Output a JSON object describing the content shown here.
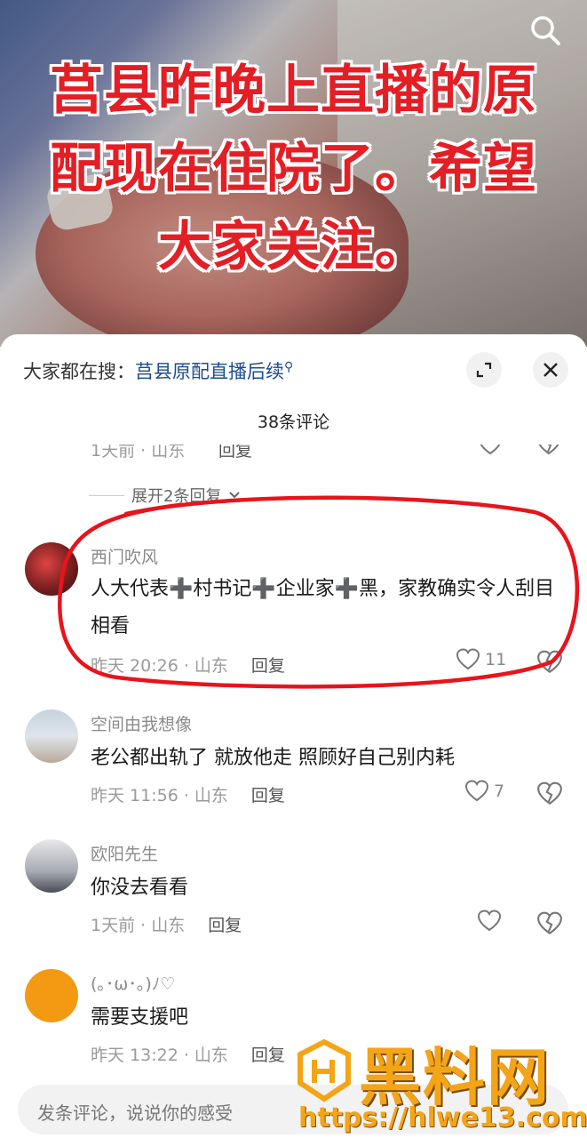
{
  "video": {
    "headline_line1": "莒县昨晚上直播的原",
    "headline_line2": "配现在住院了。希望",
    "headline_line3": "大家关注。"
  },
  "panel": {
    "topic_prefix": "大家都在搜：",
    "topic_link": "莒县原配直播后续",
    "comment_count": "38条评论",
    "partial_meta": "1天前 · 山东",
    "partial_reply": "回复",
    "expand_label": "展开2条回复"
  },
  "comments": [
    {
      "username": "西门吹风",
      "text": "人大代表➕村书记➕企业家➕黑，家教确实令人刮目相看",
      "time_loc": "昨天 20:26 · 山东",
      "reply": "回复",
      "likes": "11",
      "avatar_color": "#8a2a2a"
    },
    {
      "username": "空间由我想像",
      "text": "老公都出轨了 就放他走 照顾好自己别内耗",
      "time_loc": "昨天 11:56 · 山东",
      "reply": "回复",
      "likes": "7",
      "avatar_color": "#c9d3de"
    },
    {
      "username": "欧阳先生",
      "text": "你没去看看",
      "time_loc": "1天前 · 山东",
      "reply": "回复",
      "likes": "",
      "avatar_color": "#b9bcc2"
    },
    {
      "username": "(｡･ω･｡)ﾉ♡",
      "text": "需要支援吧",
      "time_loc": "昨天 13:22 · 山东",
      "reply": "回复",
      "likes": "",
      "avatar_color": "#f39a12"
    }
  ],
  "input": {
    "placeholder": "发条评论，说说你的感受"
  },
  "watermark": {
    "title": "黑料网",
    "url": "https://hlwe13.com"
  },
  "colors": {
    "headline": "#e41e25",
    "link": "#1a4d8f",
    "annotation": "#e8141b",
    "watermark": "#f4a417"
  }
}
